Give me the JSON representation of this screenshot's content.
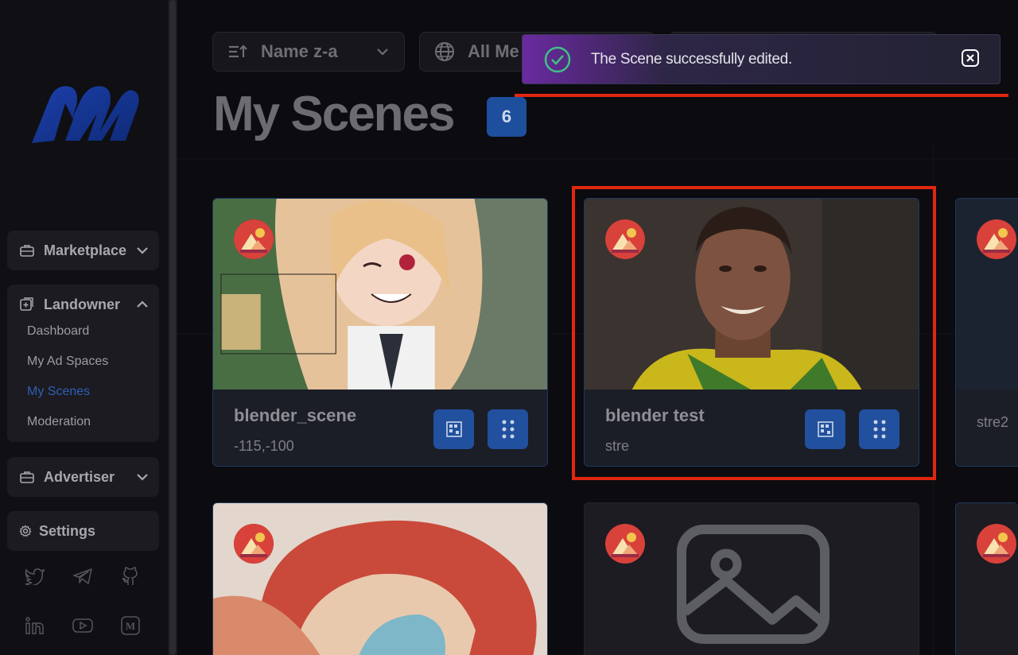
{
  "sidebar": {
    "marketplace": "Marketplace",
    "landowner": "Landowner",
    "landowner_items": [
      "Dashboard",
      "My Ad Spaces",
      "My Scenes",
      "Moderation"
    ],
    "advertiser": "Advertiser",
    "settings": "Settings",
    "social": [
      "twitter-icon",
      "telegram-icon",
      "github-icon",
      "linkedin-icon",
      "youtube-icon",
      "medium-icon"
    ]
  },
  "toolbar": {
    "sort_label": "Name z-a",
    "filter_label": "All Me"
  },
  "page": {
    "title": "My Scenes",
    "count": "6"
  },
  "scenes": [
    {
      "name": "blender_scene",
      "sub": "-115,-100"
    },
    {
      "name": "blender test",
      "sub": "stre"
    },
    {
      "name": "",
      "sub": "stre2"
    }
  ],
  "toast": {
    "message": "The Scene successfully edited."
  },
  "colors": {
    "accent": "#21509e",
    "active_link": "#2f5fb5",
    "highlight": "#e1260f"
  }
}
